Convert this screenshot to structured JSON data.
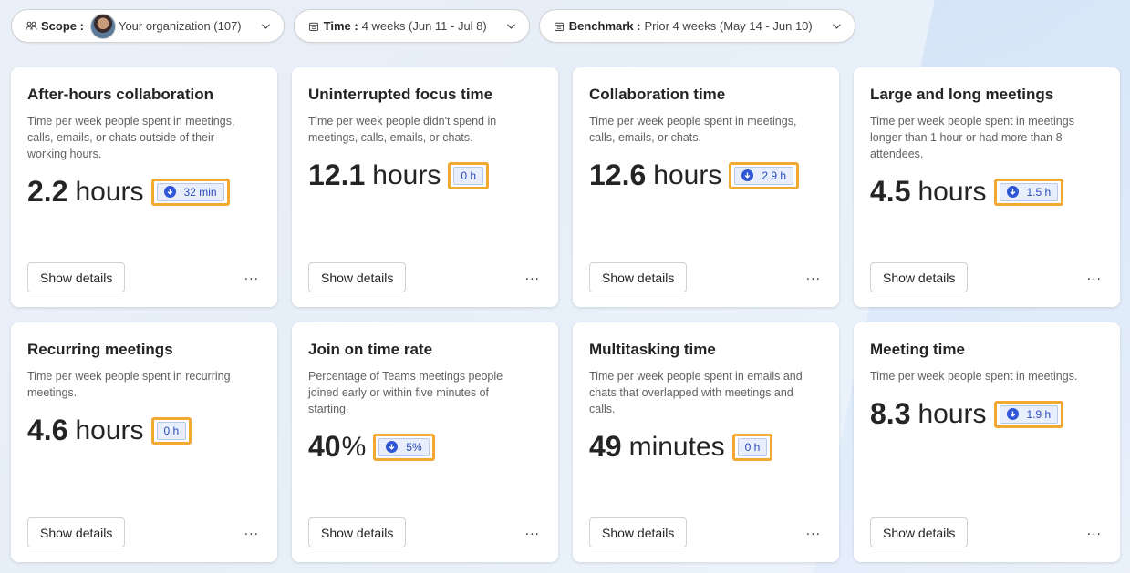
{
  "filters": {
    "scope": {
      "label": "Scope :",
      "value": "Your organization (107)",
      "icon": "people-icon"
    },
    "time": {
      "label": "Time :",
      "value": "4 weeks (Jun 11 - Jul 8)",
      "icon": "calendar-icon"
    },
    "benchmark": {
      "label": "Benchmark :",
      "value": "Prior 4 weeks (May 14 - Jun 10)",
      "icon": "calendar-icon"
    }
  },
  "cards": [
    {
      "title": "After-hours collaboration",
      "desc": "Time per week people spent in meetings, calls, emails, or chats outside of their working hours.",
      "value": "2.2",
      "unit": "hours",
      "delta": "32 min",
      "delta_direction": "down"
    },
    {
      "title": "Uninterrupted focus time",
      "desc": "Time per week people didn't spend in meetings, calls, emails, or chats.",
      "value": "12.1",
      "unit": "hours",
      "delta": "0 h",
      "delta_direction": "none"
    },
    {
      "title": "Collaboration time",
      "desc": "Time per week people spent in meetings, calls, emails, or chats.",
      "value": "12.6",
      "unit": "hours",
      "delta": "2.9 h",
      "delta_direction": "down"
    },
    {
      "title": "Large and long meetings",
      "desc": "Time per week people spent in meetings longer than 1 hour or had more than 8 attendees.",
      "value": "4.5",
      "unit": "hours",
      "delta": "1.5 h",
      "delta_direction": "down"
    },
    {
      "title": "Recurring meetings",
      "desc": "Time per week people spent in recurring meetings.",
      "value": "4.6",
      "unit": "hours",
      "delta": "0 h",
      "delta_direction": "none"
    },
    {
      "title": "Join on time rate",
      "desc": "Percentage of Teams meetings people joined early or within five minutes of starting.",
      "value": "40",
      "unit": "%",
      "delta": "5%",
      "delta_direction": "down"
    },
    {
      "title": "Multitasking time",
      "desc": "Time per week people spent in emails and chats that overlapped with meetings and calls.",
      "value": "49",
      "unit": "minutes",
      "delta": "0 h",
      "delta_direction": "none"
    },
    {
      "title": "Meeting time",
      "desc": "Time per week people spent in meetings.",
      "value": "8.3",
      "unit": "hours",
      "delta": "1.9 h",
      "delta_direction": "down"
    }
  ],
  "actions": {
    "show_details": "Show details",
    "more": "..."
  },
  "colors": {
    "highlight": "#f2a931",
    "delta_bg": "#e8eefc",
    "delta_text": "#2b4dbb",
    "down_icon": "#2f56d4"
  }
}
